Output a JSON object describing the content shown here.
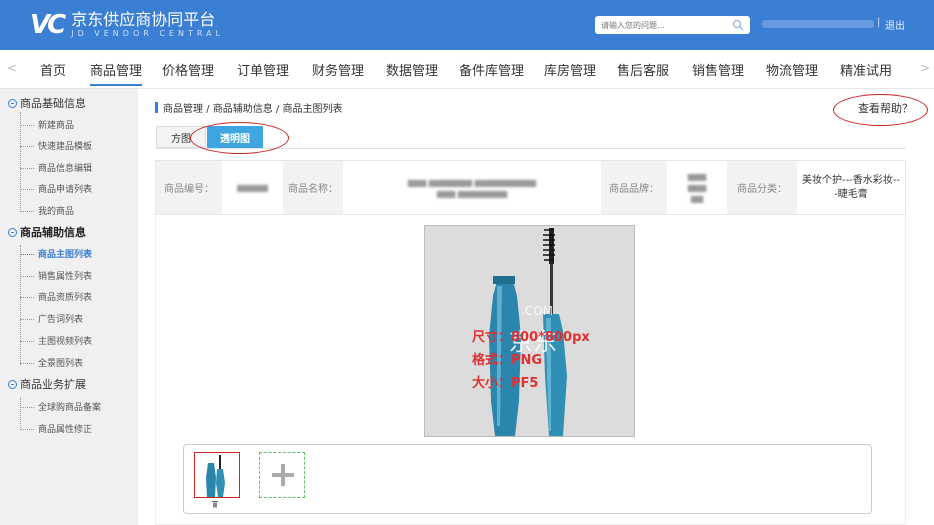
{
  "header": {
    "logo_mark": "VC",
    "logo_cn": "京东供应商协同平台",
    "logo_en": "JD VENDOR CENTRAL",
    "search_placeholder": "请输入您的问题...",
    "separator": "|",
    "logout": "退出"
  },
  "nav": {
    "left_arrow": "<",
    "right_arrow": ">",
    "items": [
      {
        "label": "首页"
      },
      {
        "label": "商品管理"
      },
      {
        "label": "价格管理"
      },
      {
        "label": "订单管理"
      },
      {
        "label": "财务管理"
      },
      {
        "label": "数据管理"
      },
      {
        "label": "备件库管理"
      },
      {
        "label": "库房管理"
      },
      {
        "label": "售后客服"
      },
      {
        "label": "销售管理"
      },
      {
        "label": "物流管理"
      },
      {
        "label": "精准试用"
      }
    ],
    "active": "商品管理"
  },
  "sidebar": {
    "groups": [
      {
        "label": "商品基础信息",
        "items": [
          "新建商品",
          "快速建品模板",
          "商品信息编辑",
          "商品申请列表",
          "我的商品"
        ]
      },
      {
        "label": "商品辅助信息",
        "items": [
          "商品主图列表",
          "销售属性列表",
          "商品资质列表",
          "广告词列表",
          "主图视频列表",
          "全景图列表"
        ]
      },
      {
        "label": "商品业务扩展",
        "items": [
          "全球购商品备案",
          "商品属性修正"
        ]
      }
    ],
    "active_item": "商品主图列表"
  },
  "breadcrumb": "商品管理 / 商品辅助信息 / 商品主图列表",
  "help_link": "查看帮助？",
  "tabs": {
    "square": "方图",
    "transparent": "透明图",
    "active": "透明图"
  },
  "product_info": {
    "code_label": "商品编号：",
    "name_label": "商品名称：",
    "brand_label": "商品品牌：",
    "category_label": "商品分类：",
    "category_value": "美妆个护---香水彩妆---睫毛膏"
  },
  "image_overlay": {
    "watermark_cn": "京东",
    "watermark_en": ".COM",
    "spec_size": "尺寸：800*800px",
    "spec_format": "格式：PNG",
    "spec_filesize": "大小：PF5"
  },
  "colors": {
    "brand_blue": "#3b7fd4",
    "tab_active": "#3ea5e0",
    "annotation_red": "#cc2222",
    "mascara_teal": "#2f8fb5"
  }
}
